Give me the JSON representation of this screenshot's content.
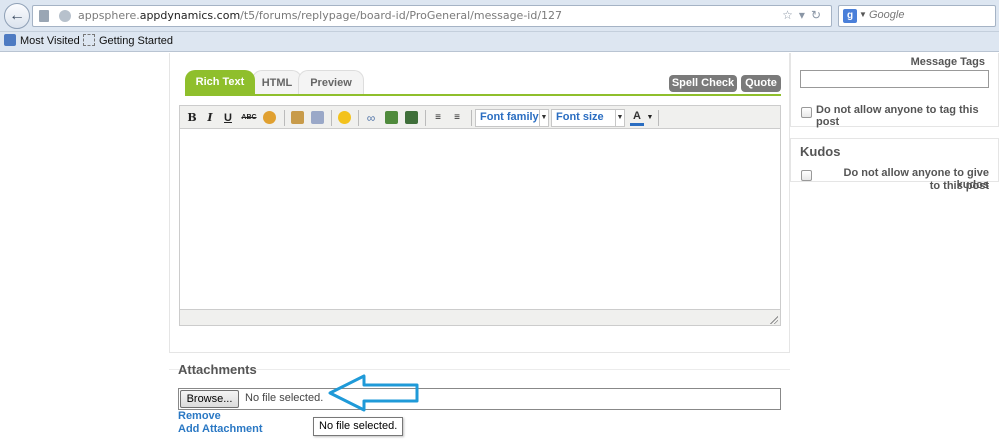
{
  "browser": {
    "url_prefix": "appsphere.",
    "url_domain": "appdynamics.com",
    "url_path": "/t5/forums/replypage/board-id/ProGeneral/message-id/127",
    "search_placeholder": "Google",
    "search_engine_letter": "g",
    "bookmarks": [
      "Most Visited",
      "Getting Started"
    ]
  },
  "editor": {
    "tabs": [
      "Rich Text",
      "HTML",
      "Preview"
    ],
    "active_tab": "Rich Text",
    "spell_check_label": "Spell Check",
    "quote_label": "Quote",
    "toolbar": {
      "bold": "B",
      "italic": "I",
      "underline": "U",
      "strike": "ABC",
      "font_family": "Font family",
      "font_size": "Font size",
      "font_color": "A"
    },
    "accent_color": "#8fbf2c"
  },
  "attachments": {
    "title": "Attachments",
    "browse_label": "Browse...",
    "file_status": "No file selected.",
    "remove_label": "Remove",
    "add_label": "Add Attachment",
    "tooltip": "No file selected."
  },
  "sidebar": {
    "message_tags_label": "Message Tags",
    "no_tag_label": "Do not allow anyone to tag this post",
    "kudos_title": "Kudos",
    "no_kudos_label_line1": "Do not allow anyone to give kudos",
    "no_kudos_label_line2": "to this post"
  }
}
